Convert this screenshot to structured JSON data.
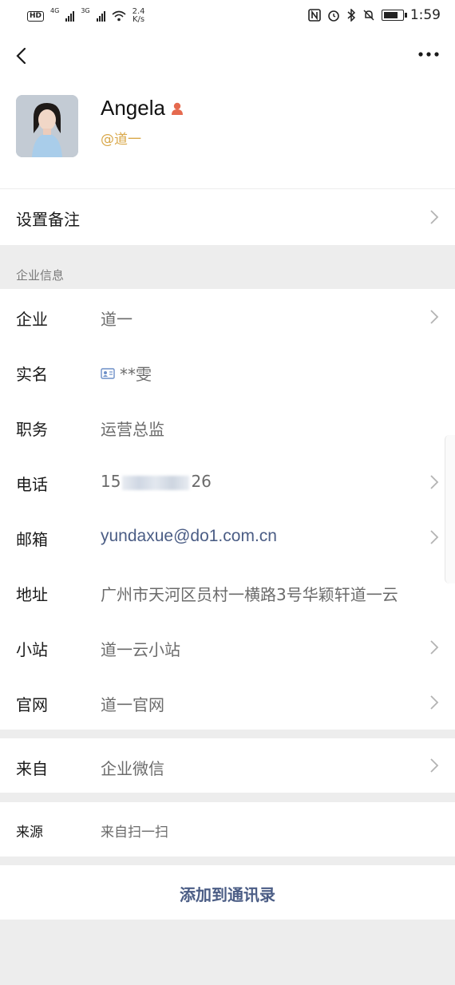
{
  "status_bar": {
    "hd": "HD",
    "sim1": "4G",
    "sim2": "3G",
    "speed_value": "2.4",
    "speed_unit": "K/s",
    "time": "1:59"
  },
  "profile": {
    "name": "Angela",
    "corp_tag": "@道一"
  },
  "remark": {
    "label": "设置备注"
  },
  "section": {
    "title": "企业信息"
  },
  "fields": {
    "company": {
      "label": "企业",
      "value": "道一"
    },
    "real_name": {
      "label": "实名",
      "value": "**雯"
    },
    "position": {
      "label": "职务",
      "value": "运营总监"
    },
    "phone": {
      "label": "电话",
      "prefix": "15",
      "suffix": "26"
    },
    "email": {
      "label": "邮箱",
      "value": "yundaxue@do1.com.cn"
    },
    "address": {
      "label": "地址",
      "value": "广州市天河区员村一横路3号华颖轩道一云"
    },
    "station": {
      "label": "小站",
      "value": "道一云小站"
    },
    "website": {
      "label": "官网",
      "value": "道一官网"
    }
  },
  "from": {
    "label": "来自",
    "value": "企业微信"
  },
  "source": {
    "label": "来源",
    "value": "来自扫一扫"
  },
  "actions": {
    "add_contact": "添加到通讯录"
  },
  "colors": {
    "accent": "#4b5d85",
    "corp_tag": "#d9a84a",
    "badge": "#e56a4f"
  }
}
